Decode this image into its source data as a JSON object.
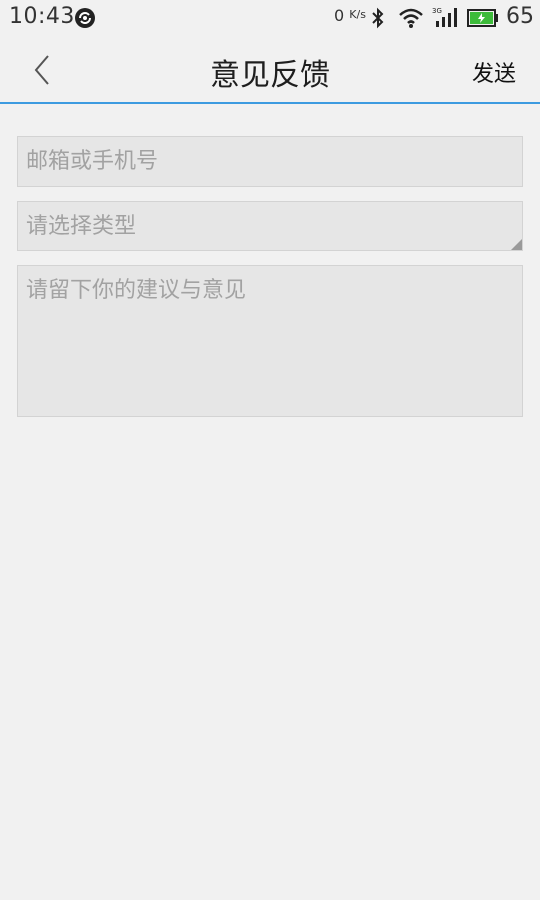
{
  "status_bar": {
    "time": "10:43",
    "net_speed": "0",
    "net_speed_unit": "K/s",
    "battery_level": "65",
    "icons": [
      "app-notification-icon",
      "bluetooth-icon",
      "wifi-icon",
      "signal-3g-icon",
      "battery-charging-icon"
    ]
  },
  "header": {
    "title": "意见反馈",
    "back_icon": "chevron-left-icon",
    "send_label": "发送",
    "accent_color": "#3d9be0"
  },
  "form": {
    "email_placeholder": "邮箱或手机号",
    "type_placeholder": "请选择类型",
    "message_placeholder": "请留下你的建议与意见"
  }
}
